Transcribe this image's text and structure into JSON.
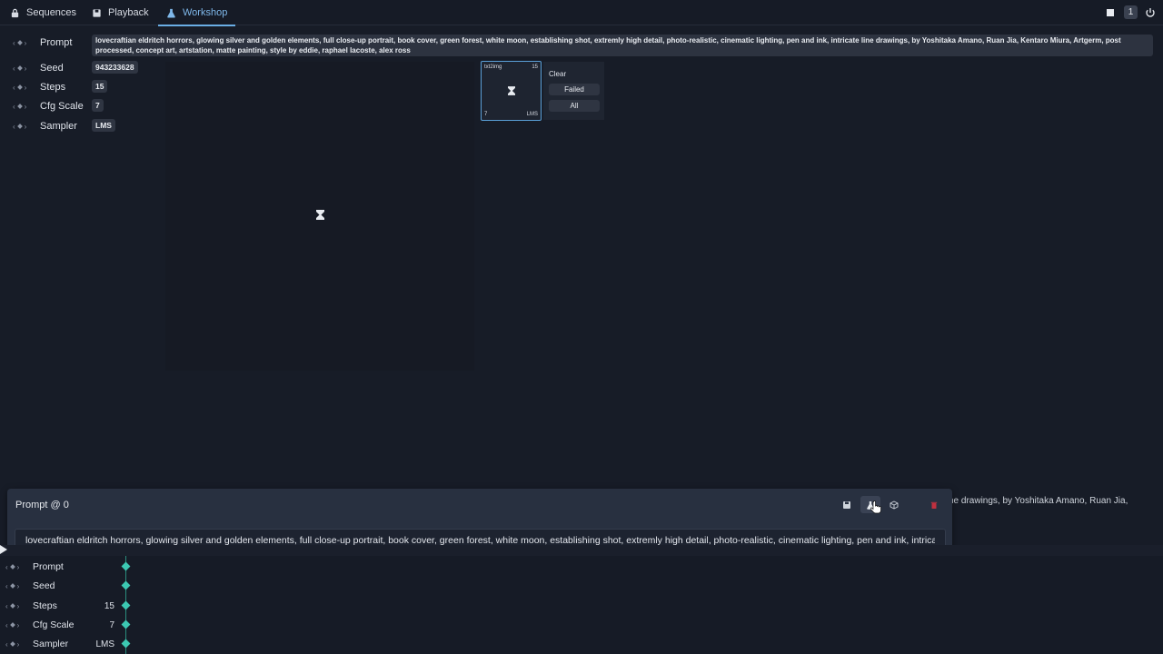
{
  "nav": {
    "tabs": [
      {
        "label": "Sequences",
        "icon": "lock-icon"
      },
      {
        "label": "Playback",
        "icon": "save-icon"
      },
      {
        "label": "Workshop",
        "icon": "flask-icon",
        "active": true
      }
    ],
    "queue_count": "1"
  },
  "params": {
    "prompt": {
      "label": "Prompt",
      "value": "lovecraftian eldritch horrors, glowing silver and golden elements, full close-up portrait, book cover, green forest, white moon, establishing shot, extremly high detail, photo-realistic, cinematic lighting, pen and ink, intricate line drawings, by Yoshitaka Amano, Ruan Jia, Kentaro Miura, Artgerm, post processed, concept art, artstation, matte painting, style by eddie, raphael lacoste, alex ross"
    },
    "seed": {
      "label": "Seed",
      "value": "943233628"
    },
    "steps": {
      "label": "Steps",
      "value": "15"
    },
    "cfg": {
      "label": "Cfg Scale",
      "value": "7"
    },
    "sampler": {
      "label": "Sampler",
      "value": "LMS"
    }
  },
  "thumbnail": {
    "mode": "txt2img",
    "steps": "15",
    "cfg": "7",
    "sampler": "LMS"
  },
  "queue_panel": {
    "clear_label": "Clear",
    "failed_button": "Failed",
    "all_button": "All"
  },
  "editor": {
    "title": "Prompt @ 0",
    "prompt_value": "lovecraftian eldritch horrors, glowing silver and golden elements, full close-up portrait, book cover, green forest, white moon, establishing shot, extremly high detail, photo-realistic, cinematic lighting, pen and ink, intricate line drawings, by Yoshitaka Amano, Ruan Jia, Kentaro Miura, Artgerm, post processed, concept art, artstation, matte painting, style by eddie, raphael lacoste, alex ross",
    "bg_tail_line1": "ne drawings, by Yoshitaka Amano, Ruan Jia,"
  },
  "timeline": {
    "rows": [
      {
        "label": "Prompt",
        "value": ""
      },
      {
        "label": "Seed",
        "value": ""
      },
      {
        "label": "Steps",
        "value": "15"
      },
      {
        "label": "Cfg Scale",
        "value": "7"
      },
      {
        "label": "Sampler",
        "value": "LMS"
      }
    ]
  },
  "colors": {
    "accent": "#6aaee5",
    "keyframe": "#3cc8b2",
    "delete": "#c0303f",
    "background": "#171c27"
  }
}
